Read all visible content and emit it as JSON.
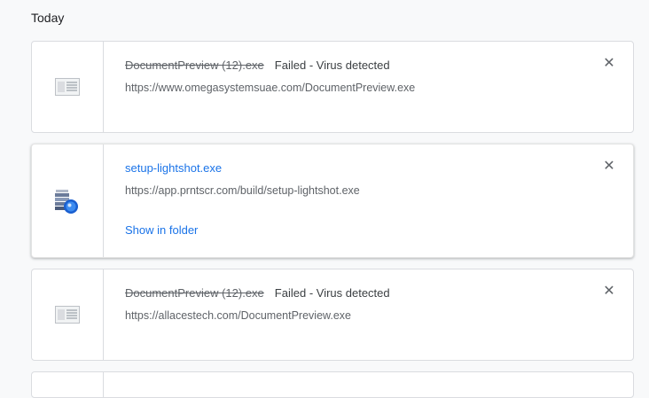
{
  "section": {
    "title": "Today"
  },
  "downloads": [
    {
      "file_name": "DocumentPreview (12).exe",
      "status": "Failed - Virus detected",
      "url": "https://www.omegasystemsuae.com/DocumentPreview.exe",
      "icon": "generic-file-icon",
      "close_label": "✕"
    },
    {
      "file_name": "setup-lightshot.exe",
      "url": "https://app.prntscr.com/build/setup-lightshot.exe",
      "action": "Show in folder",
      "icon": "installer-icon",
      "close_label": "✕"
    },
    {
      "file_name": "DocumentPreview (12).exe",
      "status": "Failed - Virus detected",
      "url": "https://allacestech.com/DocumentPreview.exe",
      "icon": "generic-file-icon",
      "close_label": "✕"
    }
  ]
}
